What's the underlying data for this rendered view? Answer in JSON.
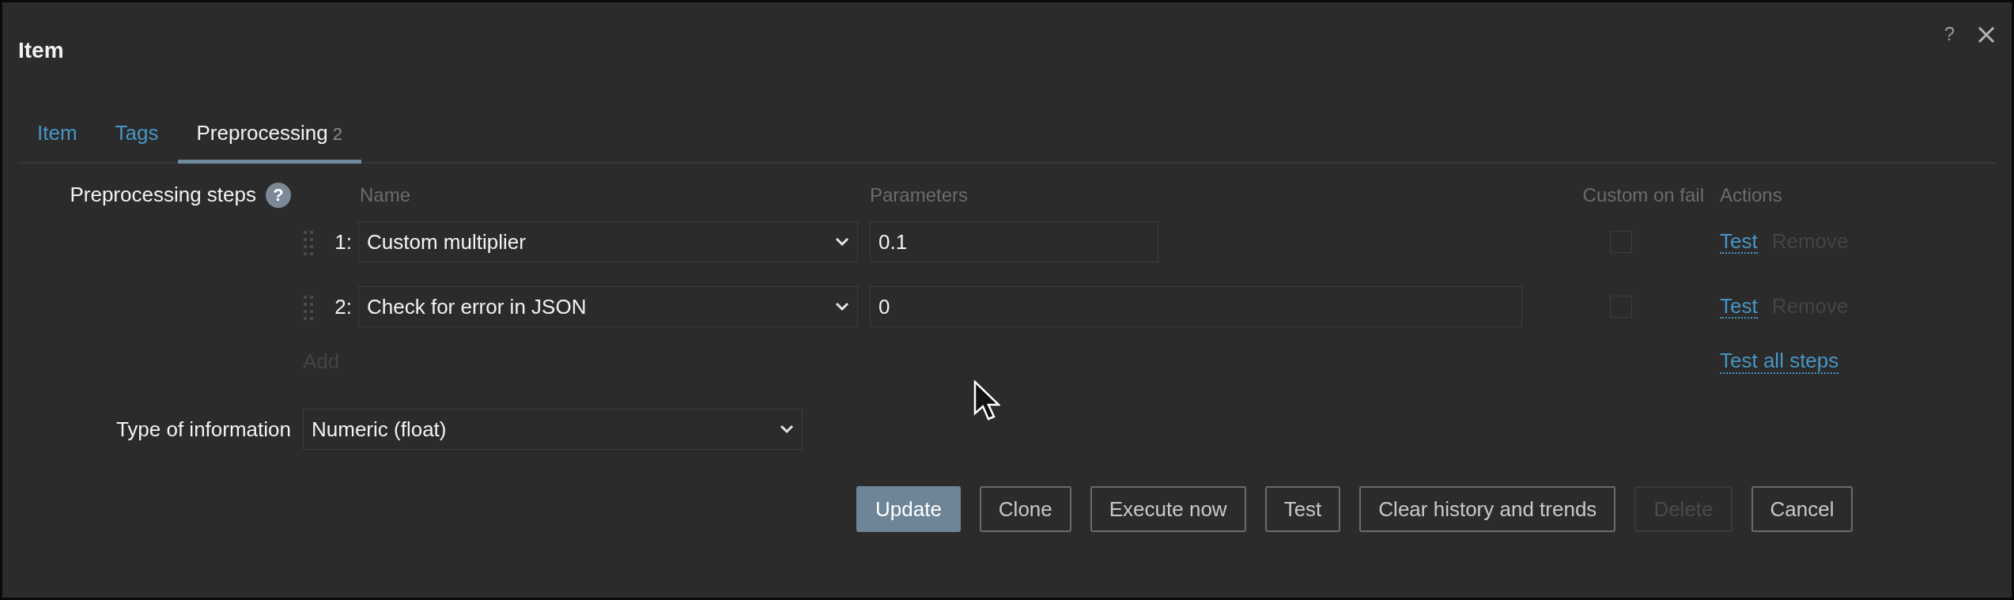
{
  "window": {
    "title": "Item",
    "help": "?"
  },
  "tabs": [
    {
      "label": "Item",
      "selected": false
    },
    {
      "label": "Tags",
      "selected": false
    },
    {
      "label": "Preprocessing",
      "count": "2",
      "selected": true
    }
  ],
  "preprocessing": {
    "label": "Preprocessing steps",
    "help": "?",
    "columns": [
      "Name",
      "Parameters",
      "Custom on fail",
      "Actions"
    ],
    "steps": [
      {
        "number": "1:",
        "name": "Custom multiplier",
        "parameter": "0.1",
        "kind": "short",
        "custom_on_fail": false,
        "actions": [
          {
            "label": "Test",
            "disabled": false
          },
          {
            "label": "Remove",
            "disabled": true
          }
        ]
      },
      {
        "number": "2:",
        "name": "Check for error in JSON",
        "parameter": "0",
        "kind": "wide",
        "custom_on_fail": false,
        "actions": [
          {
            "label": "Test",
            "disabled": false
          },
          {
            "label": "Remove",
            "disabled": true
          }
        ]
      }
    ],
    "add": {
      "label": "Add",
      "disabled": true
    },
    "test_all": "Test all steps"
  },
  "type_of_information": {
    "label": "Type of information",
    "value": "Numeric (float)"
  },
  "buttons": [
    {
      "label": "Update",
      "kind": "primary",
      "disabled": false
    },
    {
      "label": "Clone",
      "kind": "outline",
      "disabled": false
    },
    {
      "label": "Execute now",
      "kind": "outline",
      "disabled": false
    },
    {
      "label": "Test",
      "kind": "outline",
      "disabled": false
    },
    {
      "label": "Clear history and trends",
      "kind": "outline",
      "disabled": false
    },
    {
      "label": "Delete",
      "kind": "outline",
      "disabled": true
    },
    {
      "label": "Cancel",
      "kind": "outline",
      "disabled": false
    }
  ]
}
